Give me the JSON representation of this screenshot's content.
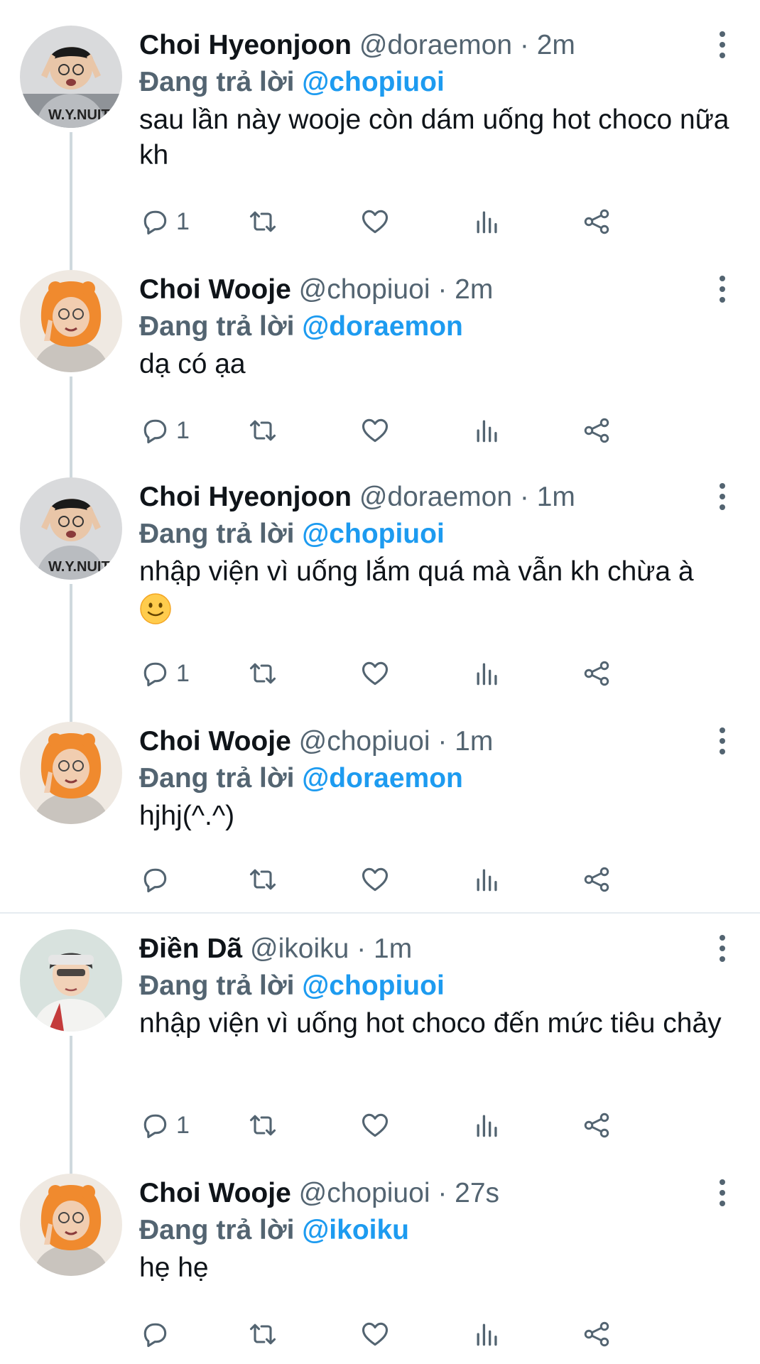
{
  "reply_prefix": "Đang trả lời",
  "tweets": [
    {
      "avatar": "avatar-hyeonjoon",
      "name": "Choi Hyeonjoon",
      "handle": "@doraemon",
      "sep": "·",
      "time": "2m",
      "reply_to": "@chopiuoi",
      "text": "sau lần này wooje còn dám uống hot choco nữa kh",
      "reply_count": "1"
    },
    {
      "avatar": "avatar-wooje",
      "name": "Choi Wooje",
      "handle": "@chopiuoi",
      "sep": "·",
      "time": "2m",
      "reply_to": "@doraemon",
      "text": "dạ có ạa",
      "reply_count": "1"
    },
    {
      "avatar": "avatar-hyeonjoon",
      "name": "Choi Hyeonjoon",
      "handle": "@doraemon",
      "sep": "·",
      "time": "1m",
      "reply_to": "@chopiuoi",
      "text": "nhập viện vì uống lắm quá mà vẫn kh chừa à",
      "text_emoji": "slightly-smiling-face",
      "reply_count": "1"
    },
    {
      "avatar": "avatar-wooje",
      "name": "Choi Wooje",
      "handle": "@chopiuoi",
      "sep": "·",
      "time": "1m",
      "reply_to": "@doraemon",
      "text": "hjhj(^.^)",
      "reply_count": ""
    },
    {
      "avatar": "avatar-diendaa",
      "name": "Điền Dã",
      "handle": "@ikoiku",
      "sep": "·",
      "time": "1m",
      "reply_to": "@chopiuoi",
      "text": "nhập viện vì uống hot choco đến mức tiêu chảy",
      "reply_count": "1"
    },
    {
      "avatar": "avatar-wooje",
      "name": "Choi Wooje",
      "handle": "@chopiuoi",
      "sep": "·",
      "time": "27s",
      "reply_to": "@ikoiku",
      "text": "hẹ hẹ",
      "reply_count": ""
    }
  ],
  "icons": {
    "reply": "reply-icon",
    "retweet": "retweet-icon",
    "like": "heart-icon",
    "views": "views-icon",
    "share": "share-icon",
    "more": "more-icon"
  },
  "colors": {
    "link": "#1d9bf0",
    "secondary": "#536471",
    "text": "#0f1419",
    "thread_line": "#cfd9de"
  }
}
